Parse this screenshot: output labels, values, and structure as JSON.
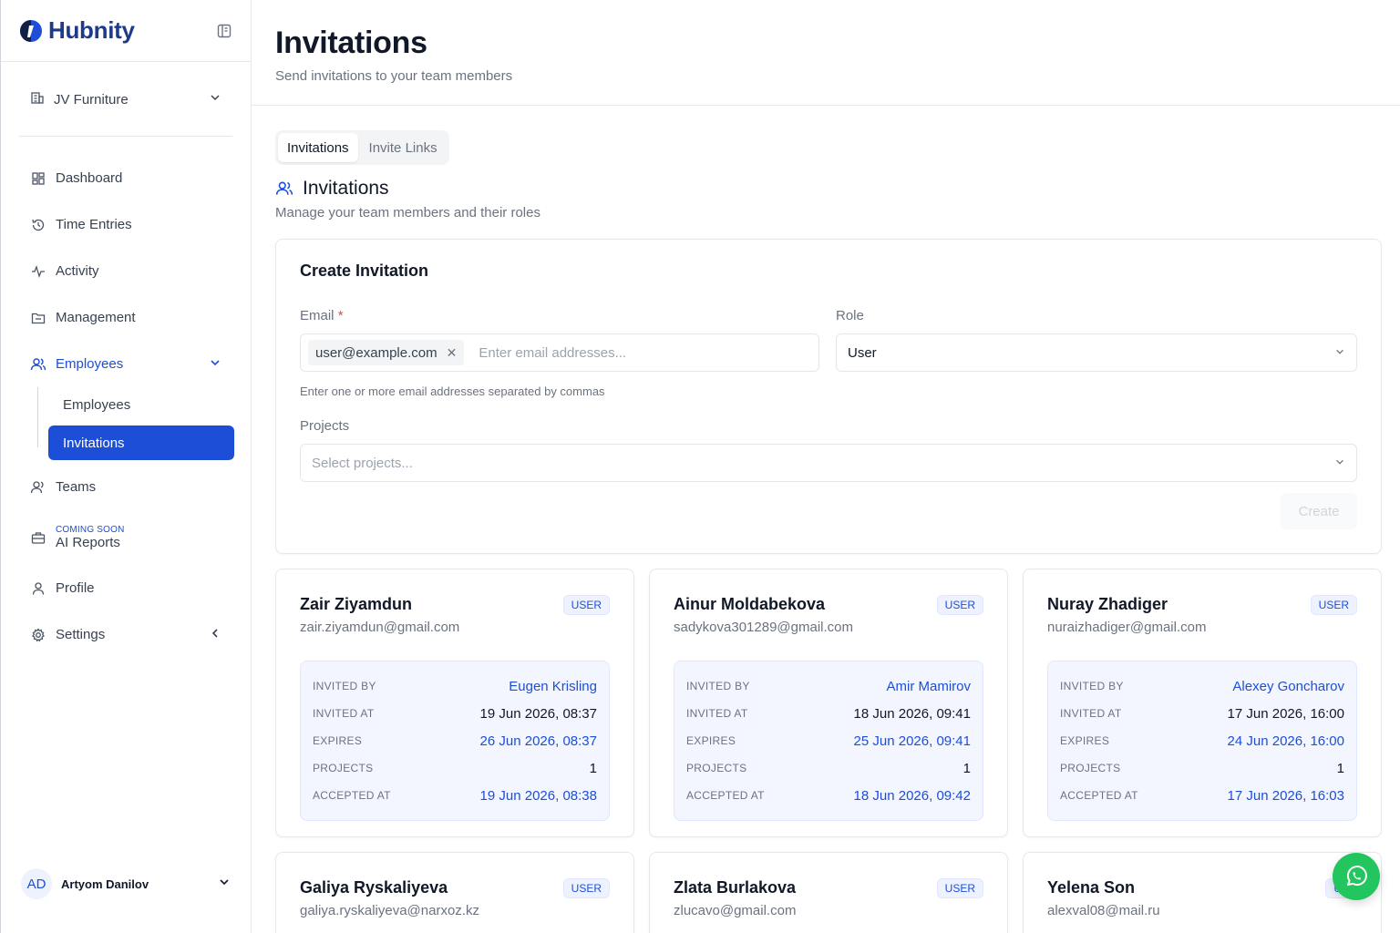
{
  "app": {
    "name": "Hubnity",
    "brand_color": "#1d4ed8"
  },
  "sidebar": {
    "org": "JV Furniture",
    "items": [
      {
        "label": "Dashboard",
        "icon": "dashboard-icon"
      },
      {
        "label": "Time Entries",
        "icon": "history-icon"
      },
      {
        "label": "Activity",
        "icon": "activity-icon"
      },
      {
        "label": "Management",
        "icon": "folder-icon"
      },
      {
        "label": "Employees",
        "icon": "users-icon"
      },
      {
        "label": "Teams",
        "icon": "team-icon"
      },
      {
        "label": "AI Reports",
        "icon": "briefcase-icon",
        "tag": "COMING SOON"
      },
      {
        "label": "Profile",
        "icon": "user-icon"
      },
      {
        "label": "Settings",
        "icon": "gear-icon"
      }
    ],
    "sub_items": [
      {
        "label": "Employees"
      },
      {
        "label": "Invitations"
      }
    ],
    "user": {
      "initials": "AD",
      "name": "Artyom Danilov"
    }
  },
  "header": {
    "title": "Invitations",
    "subtitle": "Send invitations to your team members"
  },
  "tabs": [
    {
      "label": "Invitations"
    },
    {
      "label": "Invite Links"
    }
  ],
  "section": {
    "title": "Invitations",
    "subtitle": "Manage your team members and their roles"
  },
  "create": {
    "title": "Create Invitation",
    "email_label": "Email",
    "email_required": "*",
    "email_chip": "user@example.com",
    "email_placeholder": "Enter email addresses...",
    "email_help": "Enter one or more email addresses separated by commas",
    "role_label": "Role",
    "role_value": "User",
    "projects_label": "Projects",
    "projects_placeholder": "Select projects...",
    "create_button": "Create"
  },
  "detail_labels": {
    "invited_by": "INVITED BY",
    "invited_at": "INVITED AT",
    "expires": "EXPIRES",
    "projects": "PROJECTS",
    "accepted_at": "ACCEPTED AT"
  },
  "invitations": [
    {
      "name": "Zair Ziyamdun",
      "email": "zair.ziyamdun@gmail.com",
      "role": "USER",
      "invited_by": "Eugen Krisling",
      "invited_at": "19 Jun 2026, 08:37",
      "expires": "26 Jun 2026, 08:37",
      "projects": "1",
      "accepted_at": "19 Jun 2026, 08:38"
    },
    {
      "name": "Ainur Moldabekova",
      "email": "sadykova301289@gmail.com",
      "role": "USER",
      "invited_by": "Amir Mamirov",
      "invited_at": "18 Jun 2026, 09:41",
      "expires": "25 Jun 2026, 09:41",
      "projects": "1",
      "accepted_at": "18 Jun 2026, 09:42"
    },
    {
      "name": "Nuray Zhadiger",
      "email": "nuraizhadiger@gmail.com",
      "role": "USER",
      "invited_by": "Alexey Goncharov",
      "invited_at": "17 Jun 2026, 16:00",
      "expires": "24 Jun 2026, 16:00",
      "projects": "1",
      "accepted_at": "17 Jun 2026, 16:03"
    },
    {
      "name": "Galiya Ryskaliyeva",
      "email": "galiya.ryskaliyeva@narxoz.kz",
      "role": "USER"
    },
    {
      "name": "Zlata Burlakova",
      "email": "zlucavo@gmail.com",
      "role": "USER"
    },
    {
      "name": "Yelena Son",
      "email": "alexval08@mail.ru",
      "role": "US"
    }
  ]
}
